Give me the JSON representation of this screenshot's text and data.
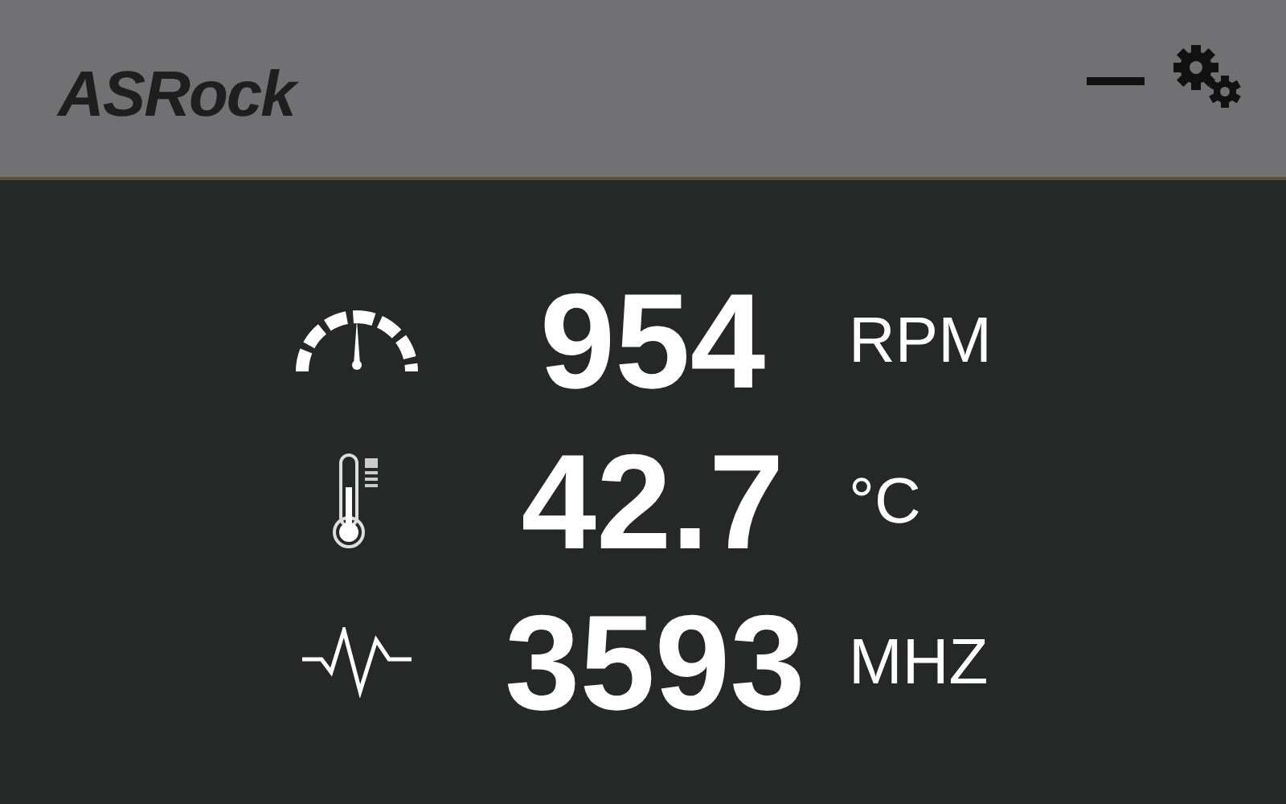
{
  "header": {
    "logo": "ASRock"
  },
  "readings": [
    {
      "kind": "fan",
      "value": "954",
      "unit": "RPM"
    },
    {
      "kind": "temperature",
      "value": "42.7",
      "unit": "°C"
    },
    {
      "kind": "frequency",
      "value": "3593",
      "unit": "MHZ"
    }
  ]
}
